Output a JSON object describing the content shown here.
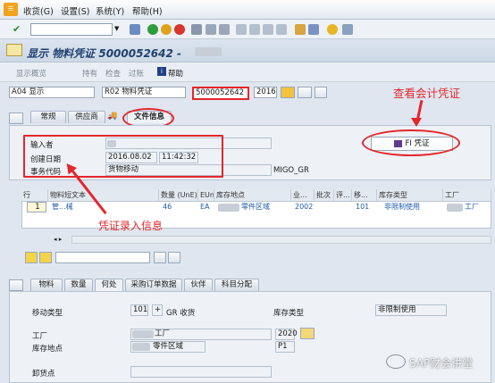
{
  "menu": {
    "items": [
      "收货(G)",
      "设置(S)",
      "系统(Y)",
      "帮助(H)"
    ]
  },
  "title": "显示 物料凭证 5000052642 -",
  "app_toolbar": {
    "items": [
      "显示概览",
      "持有",
      "检查",
      "过账"
    ],
    "help": "帮助"
  },
  "header": {
    "action": "A04 显示",
    "reference": "R02 物料凭证",
    "doc_number": "5000052642",
    "doc_year": "2016"
  },
  "top_tabs": [
    "常规",
    "供应商",
    "文件信息"
  ],
  "doc_info": {
    "entered_by_label": "输入者",
    "created_label": "创建日期",
    "created_date": "2016.08.02",
    "created_time": "11:42:32",
    "tcode_label": "事务代码",
    "tcode_value": "货物移动",
    "tcode_ref": "MIGO_GR",
    "fi_button": "FI 凭证"
  },
  "annotations": {
    "fi_note": "查看会计凭证",
    "entry_note": "凭证录入信息"
  },
  "table": {
    "headers": [
      "行",
      "物料短文本",
      "数量 (UnE)",
      "EUn",
      "库存地点",
      "业...",
      "批次",
      "评...",
      "移...",
      "库存类型",
      "工厂"
    ],
    "row": {
      "line": "1",
      "text": "管...械",
      "qty": "46",
      "unit": "EA",
      "sloc": "零件区域",
      "biz": "2002",
      "move": "101",
      "stock": "非限制使用",
      "plant": "工厂"
    }
  },
  "bottom_tabs": [
    "物料",
    "数量",
    "何处",
    "采购订单数据",
    "伙伴",
    "科目分配"
  ],
  "detail": {
    "movement_label": "移动类型",
    "movement_value": "101",
    "movement_sign": "+",
    "movement_desc": "GR 收货",
    "stock_type_label": "库存类型",
    "stock_type_value": "非限制使用",
    "plant_label": "工厂",
    "plant_value": "工厂",
    "plant_code": "2020",
    "sloc_label": "库存地点",
    "sloc_value": "零件区域",
    "sloc_code": "P1",
    "unload_label": "卸货点"
  },
  "watermark": "SAP财会讲堂"
}
